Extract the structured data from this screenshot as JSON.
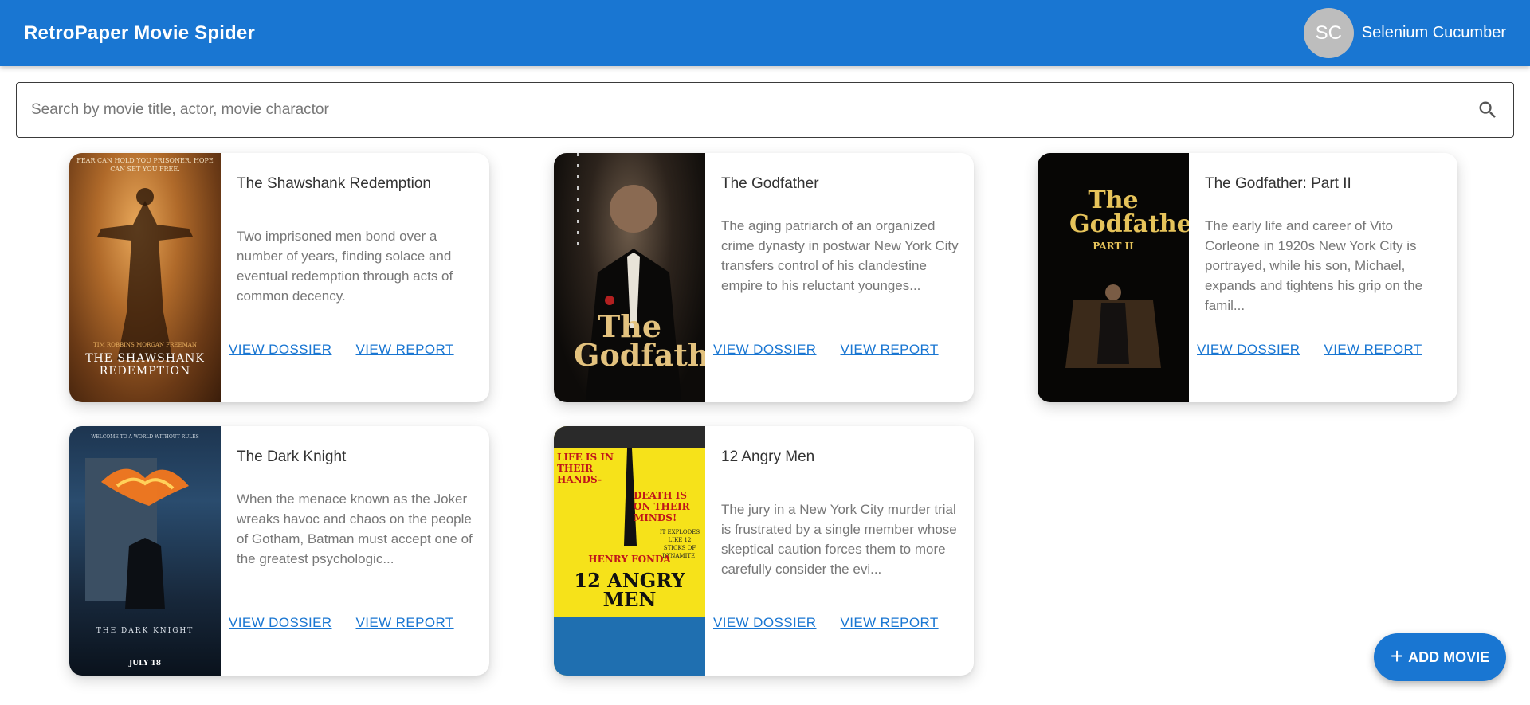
{
  "app": {
    "title": "RetroPaper Movie Spider"
  },
  "user": {
    "initials": "SC",
    "name": "Selenium Cucumber"
  },
  "search": {
    "placeholder": "Search by movie title, actor, movie charactor",
    "value": ""
  },
  "movies": [
    {
      "title": "The Shawshank Redemption",
      "description": "Two imprisoned men bond over a number of years, finding solace and eventual redemption through acts of common decency.",
      "poster": {
        "top": "FEAR CAN HOLD YOU PRISONER. HOPE CAN SET YOU FREE.",
        "credits": "TIM ROBBINS   MORGAN FREEMAN",
        "logo": "THE SHAWSHANK REDEMPTION"
      },
      "dossier_label": "VIEW DOSSIER",
      "report_label": "VIEW REPORT"
    },
    {
      "title": "The Godfather",
      "description": "The aging patriarch of an organized crime dynasty in postwar New York City transfers control of his clandestine empire to his reluctant younges...",
      "poster": {
        "logo": "The Godfather"
      },
      "dossier_label": "VIEW DOSSIER",
      "report_label": "VIEW REPORT"
    },
    {
      "title": "The Godfather: Part II",
      "description": "The early life and career of Vito Corleone in 1920s New York City is portrayed, while his son, Michael, expands and tightens his grip on the famil...",
      "poster": {
        "logo": "The Godfather",
        "sub": "PART II"
      },
      "dossier_label": "VIEW DOSSIER",
      "report_label": "VIEW REPORT"
    },
    {
      "title": "The Dark Knight",
      "description": "When the menace known as the Joker wreaks havoc and chaos on the people of Gotham, Batman must accept one of the greatest psychologic...",
      "poster": {
        "top": "WELCOME TO A WORLD WITHOUT RULES",
        "logo": "THE DARK KNIGHT",
        "date": "JULY 18"
      },
      "dossier_label": "VIEW DOSSIER",
      "report_label": "VIEW REPORT"
    },
    {
      "title": "12 Angry Men",
      "description": "The jury in a New York City murder trial is frustrated by a single member whose skeptical caution forces them to more carefully consider the evi...",
      "poster": {
        "left": "LIFE IS IN THEIR HANDS-",
        "right": "DEATH IS ON THEIR MINDS!",
        "explodes": "IT EXPLODES LIKE 12 STICKS OF DYNAMITE!",
        "actor": "HENRY FONDA",
        "logo": "12 ANGRY MEN"
      },
      "dossier_label": "VIEW DOSSIER",
      "report_label": "VIEW REPORT"
    }
  ],
  "fab": {
    "label": "ADD MOVIE"
  },
  "colors": {
    "primary": "#1976d2",
    "avatar": "#bdbdbd"
  }
}
